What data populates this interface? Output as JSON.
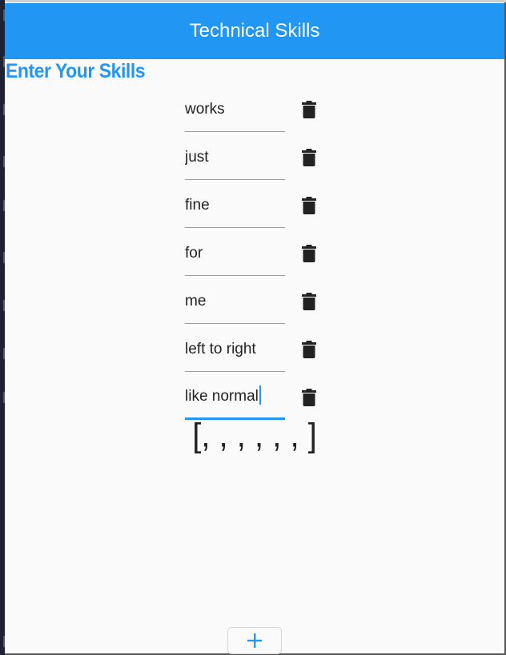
{
  "appbar": {
    "title": "Technical Skills"
  },
  "heading": "Enter Your Skills",
  "skills": [
    {
      "value": "works",
      "focused": false
    },
    {
      "value": "just",
      "focused": false
    },
    {
      "value": "fine",
      "focused": false
    },
    {
      "value": "for",
      "focused": false
    },
    {
      "value": "me",
      "focused": false
    },
    {
      "value": "left to right",
      "focused": false
    },
    {
      "value": "like normal",
      "focused": true
    }
  ],
  "delete_icon": "trash-icon",
  "result_text": "[, , , , , , ]",
  "add_button": {
    "icon": "plus-icon"
  },
  "colors": {
    "primary": "#2196f3",
    "background": "#fafafa",
    "text": "#222222"
  }
}
